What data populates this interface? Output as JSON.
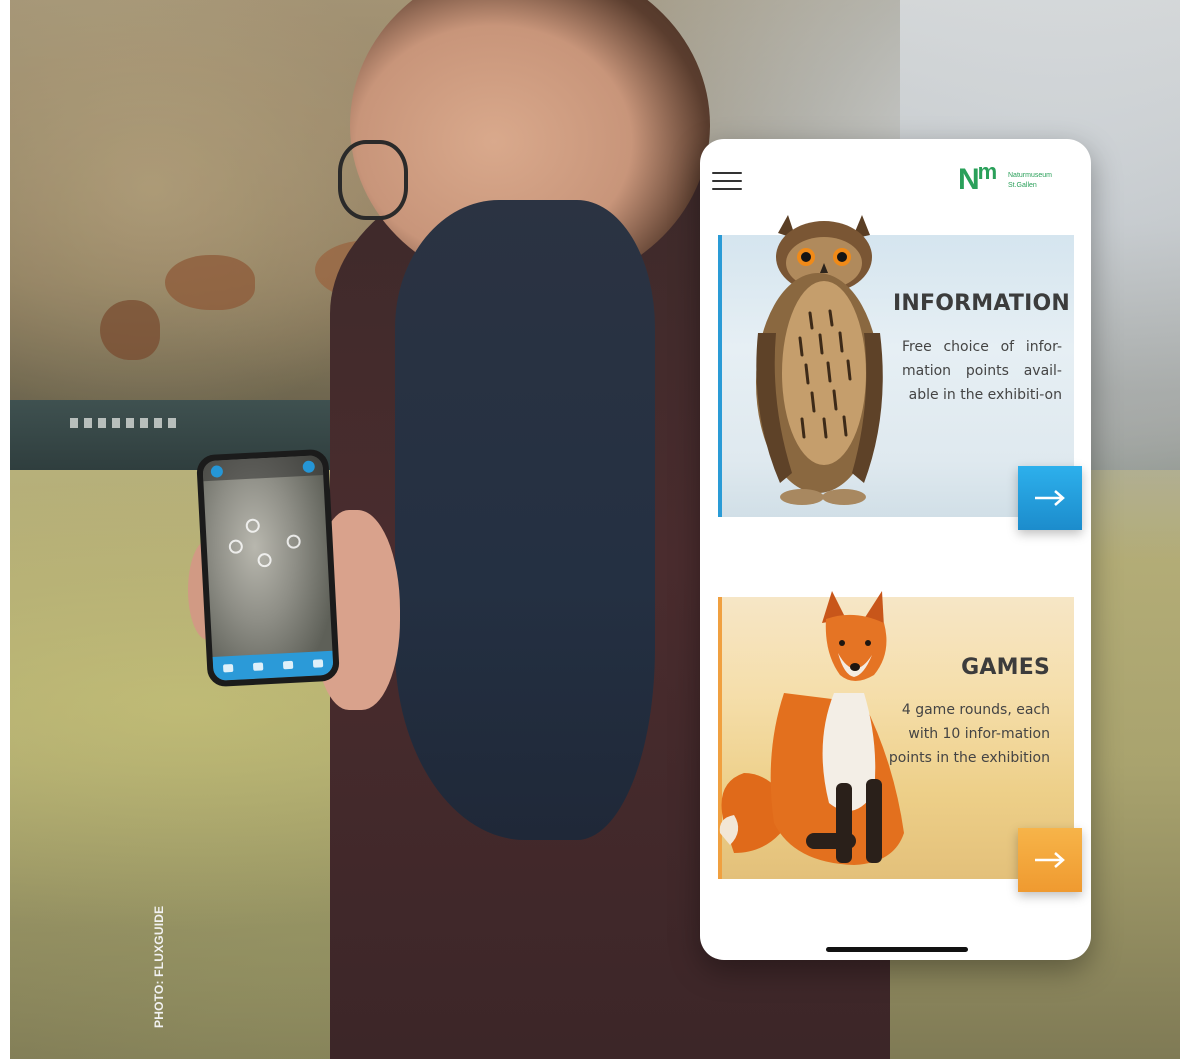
{
  "photo_credit": "PHOTO: FLUXGUIDE",
  "app": {
    "logo": {
      "mark_n": "N",
      "mark_m": "m",
      "line1": "Naturmuseum",
      "line2": "St.Gallen"
    },
    "cards": [
      {
        "title": "INFORMATION",
        "description": "Free choice of infor-mation points avail-able in the exhibiti-on",
        "arrow": "→"
      },
      {
        "title": "GAMES",
        "description": "4 game rounds, each with 10 infor-mation points in the exhibition",
        "arrow": "→"
      }
    ]
  },
  "colors": {
    "information_accent": "#2a9bd6",
    "games_accent": "#f0a040",
    "logo_green": "#2aa05a"
  }
}
